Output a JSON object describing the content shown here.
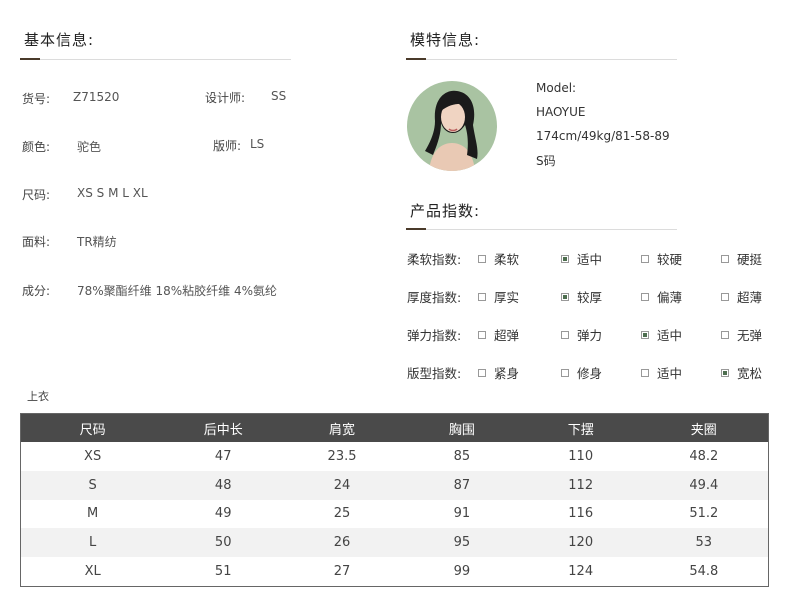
{
  "basic_info": {
    "title": "基本信息:",
    "item_no_label": "货号:",
    "item_no_value": "Z71520",
    "designer_label": "设计师:",
    "designer_value": "SS",
    "color_label": "颜色:",
    "color_value": "驼色",
    "pattern_maker_label": "版师:",
    "pattern_maker_value": "LS",
    "size_label": "尺码:",
    "size_value": "XS S M L XL",
    "fabric_label": "面料:",
    "fabric_value": "TR精纺",
    "composition_label": "成分:",
    "composition_value": "78%聚酯纤维 18%粘胶纤维 4%氨纶"
  },
  "model_info": {
    "title": "模特信息:",
    "label": "Model:",
    "name": "HAOYUE",
    "measurements": "174cm/49kg/81-58-89",
    "size": "S码"
  },
  "product_index": {
    "title": "产品指数:",
    "rows": [
      {
        "label": "柔软指数:",
        "options": [
          {
            "text": "柔软",
            "checked": false
          },
          {
            "text": "适中",
            "checked": true
          },
          {
            "text": "较硬",
            "checked": false
          },
          {
            "text": "硬挺",
            "checked": false
          }
        ]
      },
      {
        "label": "厚度指数:",
        "options": [
          {
            "text": "厚实",
            "checked": false
          },
          {
            "text": "较厚",
            "checked": true
          },
          {
            "text": "偏薄",
            "checked": false
          },
          {
            "text": "超薄",
            "checked": false
          }
        ]
      },
      {
        "label": "弹力指数:",
        "options": [
          {
            "text": "超弹",
            "checked": false
          },
          {
            "text": "弹力",
            "checked": false
          },
          {
            "text": "适中",
            "checked": true
          },
          {
            "text": "无弹",
            "checked": false
          }
        ]
      },
      {
        "label": "版型指数:",
        "options": [
          {
            "text": "紧身",
            "checked": false
          },
          {
            "text": "修身",
            "checked": false
          },
          {
            "text": "适中",
            "checked": false
          },
          {
            "text": "宽松",
            "checked": true
          }
        ]
      }
    ]
  },
  "size_table": {
    "caption": "上衣",
    "headers": [
      "尺码",
      "后中长",
      "肩宽",
      "胸围",
      "下摆",
      "夹圈"
    ],
    "rows": [
      [
        "XS",
        "47",
        "23.5",
        "85",
        "110",
        "48.2"
      ],
      [
        "S",
        "48",
        "24",
        "87",
        "112",
        "49.4"
      ],
      [
        "M",
        "49",
        "25",
        "91",
        "116",
        "51.2"
      ],
      [
        "L",
        "50",
        "26",
        "95",
        "120",
        "53"
      ],
      [
        "XL",
        "51",
        "27",
        "99",
        "124",
        "54.8"
      ]
    ]
  },
  "colors": {
    "accent_line": "#4a3a2a",
    "header_bg": "#4a4a4a",
    "checked_fill": "#4d6e4f",
    "avatar_bg": "#a9c3a2"
  },
  "icons": {
    "checkbox": "checkbox-icon",
    "model_photo": "model-photo"
  }
}
